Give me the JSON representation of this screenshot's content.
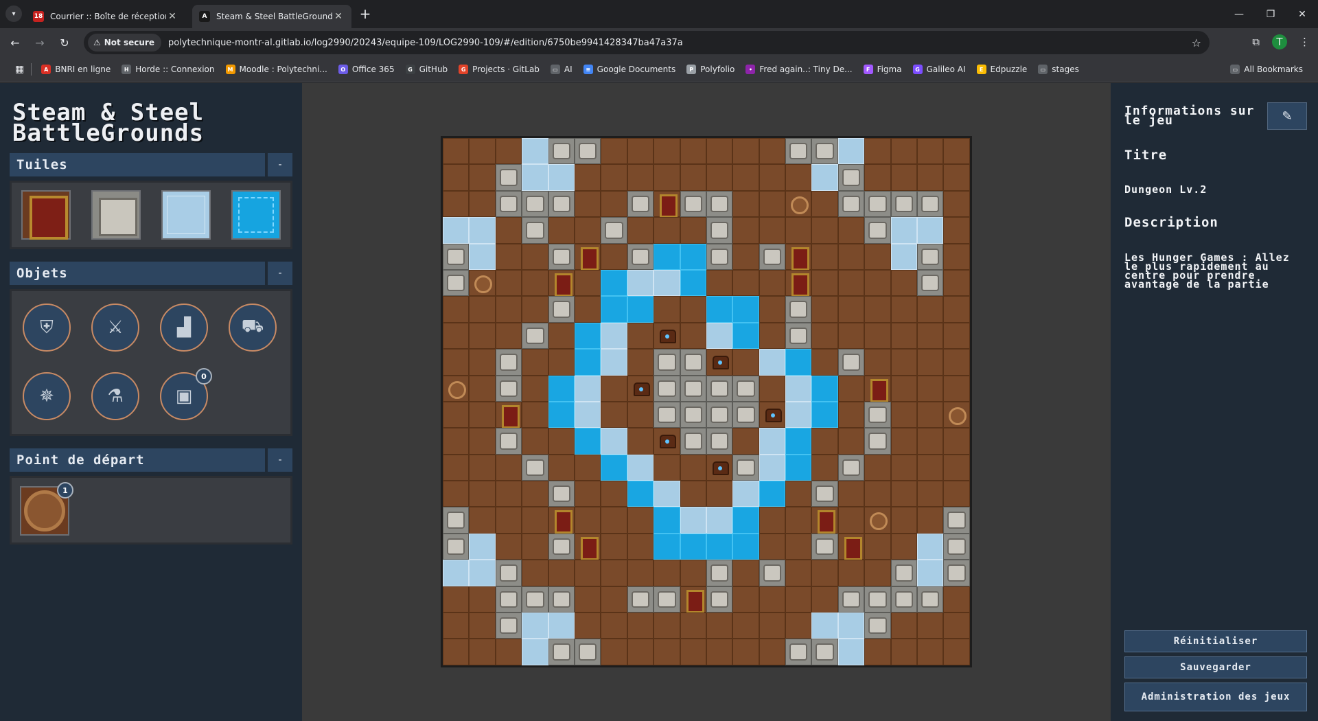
{
  "browser": {
    "tabs": [
      {
        "title": "Courrier :: Boîte de réception",
        "favicon_text": "18",
        "favicon_color": "#c5221f"
      },
      {
        "title": "Steam & Steel BattleGrounds",
        "favicon_text": "A",
        "favicon_color": "#1a1a1a"
      }
    ],
    "secure_label": "Not secure",
    "url": "polytechnique-montr-al.gitlab.io/log2990/20243/equipe-109/LOG2990-109/#/edition/6750be9941428347ba47a37a",
    "profile_initial": "T",
    "bookmarks": [
      {
        "label": "BNRI en ligne",
        "color": "#d93025",
        "glyph": "A"
      },
      {
        "label": "Horde :: Connexion",
        "color": "#5f6368",
        "glyph": "H"
      },
      {
        "label": "Moodle : Polytechni...",
        "color": "#f29900",
        "glyph": "M"
      },
      {
        "label": "Office 365",
        "color": "#6c5ce7",
        "glyph": "O"
      },
      {
        "label": "GitHub",
        "color": "#3c4043",
        "glyph": "G"
      },
      {
        "label": "Projects · GitLab",
        "color": "#e24329",
        "glyph": "G"
      },
      {
        "label": "AI",
        "color": "#5f6368",
        "glyph": "▭"
      },
      {
        "label": "Google Documents",
        "color": "#4285f4",
        "glyph": "≡"
      },
      {
        "label": "Polyfolio",
        "color": "#9aa0a6",
        "glyph": "P"
      },
      {
        "label": "Fred again..: Tiny De...",
        "color": "#8e24aa",
        "glyph": "•"
      },
      {
        "label": "Figma",
        "color": "#a259ff",
        "glyph": "F"
      },
      {
        "label": "Galileo AI",
        "color": "#7c4dff",
        "glyph": "G"
      },
      {
        "label": "Edpuzzle",
        "color": "#fbbc04",
        "glyph": "E"
      },
      {
        "label": "stages",
        "color": "#5f6368",
        "glyph": "▭"
      }
    ],
    "all_bookmarks": "All Bookmarks"
  },
  "app": {
    "logo_line1": "Steam & Steel",
    "logo_line2": "BattleGrounds",
    "sections": {
      "tiles": {
        "label": "Tuiles",
        "toggle": "-"
      },
      "objects": {
        "label": "Objets",
        "toggle": "-"
      },
      "start": {
        "label": "Point de départ",
        "toggle": "-"
      }
    },
    "tiles": [
      "door",
      "wall",
      "ice",
      "water"
    ],
    "objects": [
      {
        "icon": "armor-icon",
        "glyph": "⛨"
      },
      {
        "icon": "sword-icon",
        "glyph": "⚔"
      },
      {
        "icon": "boots-icon",
        "glyph": "▟"
      },
      {
        "icon": "cart-icon",
        "glyph": "⛟"
      },
      {
        "icon": "compass-icon",
        "glyph": "✵"
      },
      {
        "icon": "potion-icon",
        "glyph": "⚗"
      },
      {
        "icon": "chest-icon",
        "glyph": "▣",
        "badge": "0"
      }
    ],
    "start_badge": "1",
    "info": {
      "heading": "Informations sur le jeu",
      "title_label": "Titre",
      "title_value": "Dungeon Lv.2",
      "description_label": "Description",
      "description_value": "Les Hunger Games : Allez le plus rapidement au centre pour prendre avantage de la partie"
    },
    "actions": {
      "reset": "Réinitialiser",
      "save": "Sauvegarder",
      "admin": "Administration des jeux"
    },
    "map": [
      "...IWW.......WWI....",
      "..WII.........IW....",
      "..WWW..WDWW..s.WWWW.",
      "II.W..W...W.....WII.",
      "WI..WD.WAAW.WD...IW.",
      "Ws..D.AIIA...D....W.",
      "....W.AA..AA.W......",
      "...W.AI.c.IA.W......",
      "..W..AI.WWc.IA.W....",
      "s.W.AI.cWWWW.IA.D...",
      "..D.AI..WWWWcIA.W..s",
      "..W..AI.cWW.IA..W...",
      "...W..AI..cWIA.W....",
      "....W..AI..IA.W.....",
      "W...D...AIIA..D.s..W",
      "WI..WD..AAAA..WD..IW",
      "IIW.......W.W....WIW",
      "..WWW..WWDW....WWWW.",
      "..WII.........IIW...",
      "...IWW.......WWI...."
    ]
  }
}
